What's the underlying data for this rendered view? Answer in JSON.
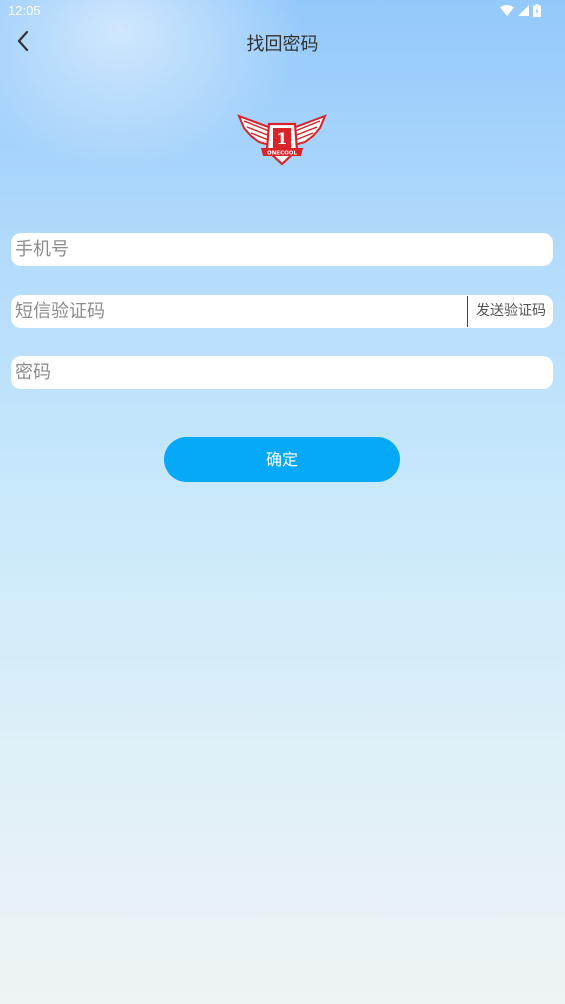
{
  "status_bar": {
    "time": "12:05"
  },
  "header": {
    "title": "找回密码",
    "back_icon": "chevron-left-icon"
  },
  "logo": {
    "icon": "onecool-winged-shield-logo",
    "number": "1",
    "text": "ONECOOL",
    "color": "#d8232a"
  },
  "form": {
    "phone_placeholder": "手机号",
    "sms_placeholder": "短信验证码",
    "send_code_label": "发送验证码",
    "password_placeholder": "密码",
    "confirm_label": "确定"
  },
  "colors": {
    "accent": "#06a8f8",
    "background_top": "#94c9fb",
    "background_bottom": "#eef3f4"
  }
}
